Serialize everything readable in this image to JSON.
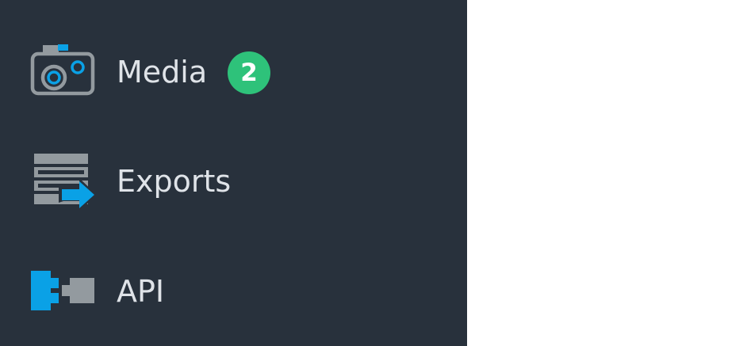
{
  "colors": {
    "sidebar_background": "#28313c",
    "label_text": "#dfe3e8",
    "icon_gray": "#939a9f",
    "icon_accent_blue": "#0aa1e6",
    "badge_green": "#2ec27a",
    "content_background": "#ffffff"
  },
  "sidebar": {
    "items": [
      {
        "label": "Media",
        "icon": "camera-icon",
        "badge": "2"
      },
      {
        "label": "Exports",
        "icon": "export-stack-icon"
      },
      {
        "label": "API",
        "icon": "api-connector-icon"
      }
    ]
  }
}
